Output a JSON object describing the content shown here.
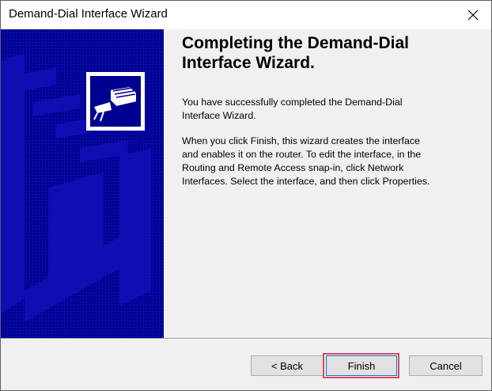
{
  "window": {
    "title": "Demand-Dial Interface Wizard",
    "close_icon": "close-icon"
  },
  "banner": {
    "logo_icon": "network-plug-icon",
    "background_color": "#000090"
  },
  "content": {
    "heading_line1": "Completing the Demand-Dial",
    "heading_line2": "Interface Wizard.",
    "para1_line1": "You have successfully completed the Demand-Dial",
    "para1_line2": "Interface Wizard.",
    "para2_line1": "When you click Finish, this wizard creates the interface",
    "para2_line2": "and enables it on the router. To edit the interface, in the",
    "para2_line3": "Routing and Remote Access snap-in,  click Network",
    "para2_line4": "Interfaces. Select the interface, and then click Properties."
  },
  "buttons": {
    "back_label": "< Back",
    "finish_label": "Finish",
    "cancel_label": "Cancel"
  },
  "colors": {
    "highlight": "#e04a5a",
    "focus_border": "#0078d7"
  }
}
